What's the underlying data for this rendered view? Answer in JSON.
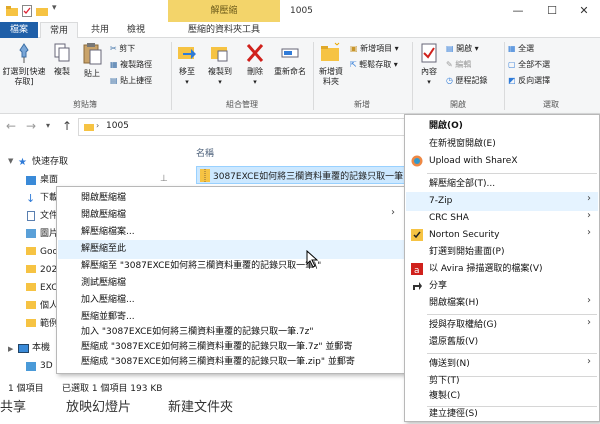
{
  "titlebar": {
    "contextual_tab_header": "解壓縮",
    "window_title": "1005",
    "minimize": "—",
    "maximize": "☐",
    "close": "✕"
  },
  "tabs": [
    "檔案",
    "常用",
    "共用",
    "檢視",
    "壓縮的資料夾工具"
  ],
  "ribbon": {
    "clipboard": {
      "pin": "釘選到[快速存取]",
      "copy": "複製",
      "paste": "貼上",
      "cut": "剪下",
      "copy_path": "複製路徑",
      "paste_shortcut": "貼上捷徑",
      "group": "剪貼簿"
    },
    "organize": {
      "move_to": "移至",
      "copy_to": "複製到",
      "delete": "刪除",
      "rename": "重新命名",
      "group": "組合管理"
    },
    "new": {
      "new_folder": "新增資料夾",
      "new_item": "新增項目",
      "easy_access": "輕鬆存取",
      "group": "新增"
    },
    "open": {
      "properties": "內容",
      "open": "開啟",
      "edit": "編輯",
      "history": "歷程記錄",
      "group": "開啟"
    },
    "select": {
      "select_all": "全選",
      "select_none": "全部不選",
      "invert": "反向選擇",
      "group": "選取"
    }
  },
  "address": {
    "path": "1005"
  },
  "file_list": {
    "column_name": "名稱",
    "selected_file": "3087EXCE如何將三欄資料重覆的記錄只取一筆.zip"
  },
  "nav": {
    "items": [
      "快速存取",
      "桌面",
      "下載",
      "文件",
      "圖片",
      "Goo",
      "2020",
      "EXC",
      "個人",
      "範例",
      "本機",
      "3D"
    ]
  },
  "status": {
    "count": "1 個項目",
    "selected": "已選取 1 個項目  193 KB"
  },
  "bottom_strip": {
    "items": [
      "共享",
      "放映幻燈片",
      "新建文件夾"
    ]
  },
  "submenu_7zip": {
    "items": [
      "開啟壓縮檔",
      "開啟壓縮檔",
      "解壓縮檔案...",
      "解壓縮至此",
      "解壓縮至 \"3087EXCE如何將三欄資料重覆的記錄只取一筆\\\"",
      "測試壓縮檔",
      "加入壓縮檔...",
      "壓縮並郵寄...",
      "加入 \"3087EXCE如何將三欄資料重覆的記錄只取一筆.7z\"",
      "壓縮成 \"3087EXCE如何將三欄資料重覆的記錄只取一筆.7z\" 並郵寄",
      "壓縮成 \"3087EXCE如何將三欄資料重覆的記錄只取一筆.zip\" 並郵寄"
    ]
  },
  "context_menu": {
    "items": [
      "開啟(O)",
      "在新視窗開啟(E)",
      "Upload with ShareX",
      "解壓縮全部(T)...",
      "7-Zip",
      "CRC SHA",
      "Norton Security",
      "釘選到開始畫面(P)",
      "以 Avira 掃描選取的檔案(V)",
      "分享",
      "開啟檔案(H)",
      "授與存取權給(G)",
      "還原舊版(V)",
      "傳送到(N)",
      "剪下(T)",
      "複製(C)",
      "建立捷徑(S)"
    ]
  },
  "colors": {
    "file_tab": "#1f5fa8",
    "contextual": "#f3d46a",
    "selection": "#cce8ff",
    "menu_hover": "#e5f3ff"
  }
}
